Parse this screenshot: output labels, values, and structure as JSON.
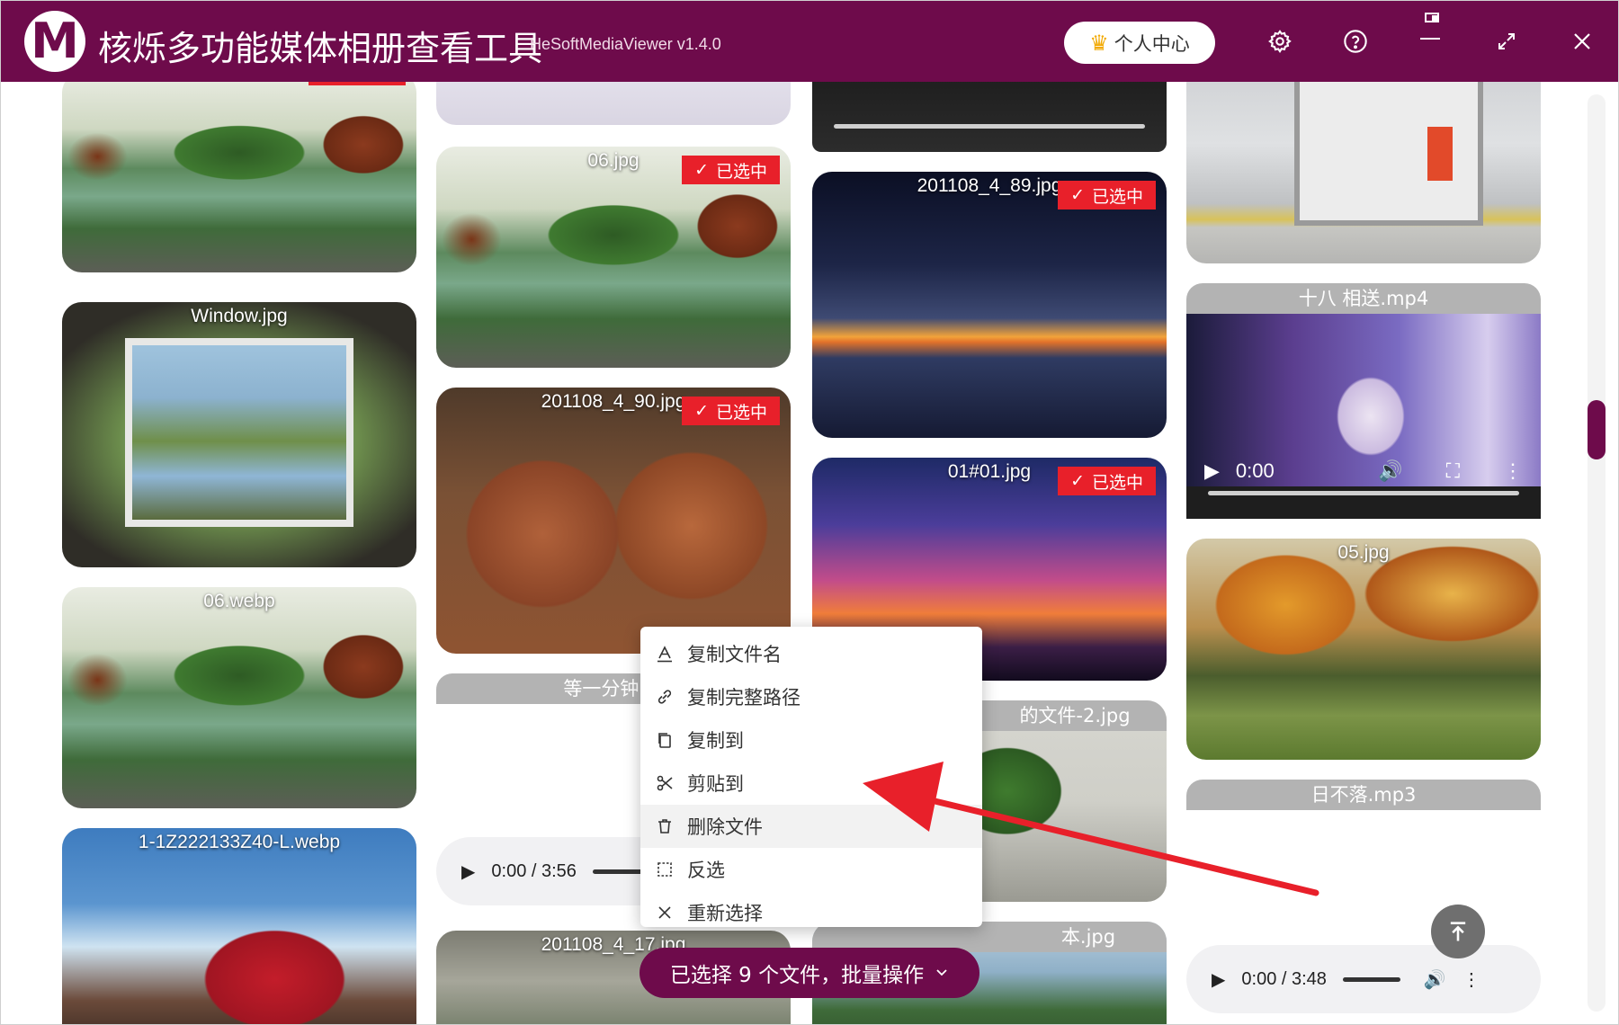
{
  "app": {
    "logo_letter": "M",
    "title": "核烁多功能媒体相册查看工具",
    "subtitle": "HeSoftMediaViewer v1.4.0",
    "user_center": "个人中心"
  },
  "icons": {
    "settings": "gear-icon",
    "help": "question-icon",
    "minimize": "minimize-icon",
    "maximize": "expand-icon",
    "close": "close-icon"
  },
  "selected_badge": "已选中",
  "cards": {
    "window": "Window.jpg",
    "webp06": "06.webp",
    "wedding": "1-1Z222133Z40-L.webp",
    "jpg06": "06.jpg",
    "elephant": "201108_4_90.jpg",
    "wait": "等一分钟.m",
    "cloud": "201108_4_17.jpg",
    "sunset": "201108_4_89.jpg",
    "palm": "01#01.jpg",
    "plant": "的文件-2.jpg",
    "trees": "本.jpg",
    "mp4": "十八 相送.mp4",
    "autumn": "05.jpg",
    "mp3": "日不落.mp3"
  },
  "players": {
    "video_time": "0:00",
    "audio_mid_time": "0:00 / 3:56",
    "audio_right_time": "0:00 / 3:48"
  },
  "context_menu": [
    {
      "label": "复制文件名",
      "icon": "text-a-icon"
    },
    {
      "label": "复制完整路径",
      "icon": "link-icon"
    },
    {
      "label": "复制到",
      "icon": "copy-icon"
    },
    {
      "label": "剪贴到",
      "icon": "scissors-icon"
    },
    {
      "label": "删除文件",
      "icon": "trash-icon"
    },
    {
      "label": "反选",
      "icon": "select-box-icon"
    },
    {
      "label": "重新选择",
      "icon": "x-icon"
    }
  ],
  "batch_button": "已选择 9 个文件，批量操作",
  "colors": {
    "brand": "#6e0b4b",
    "selected_badge": "#e8202a",
    "arrow": "#e8202a"
  }
}
